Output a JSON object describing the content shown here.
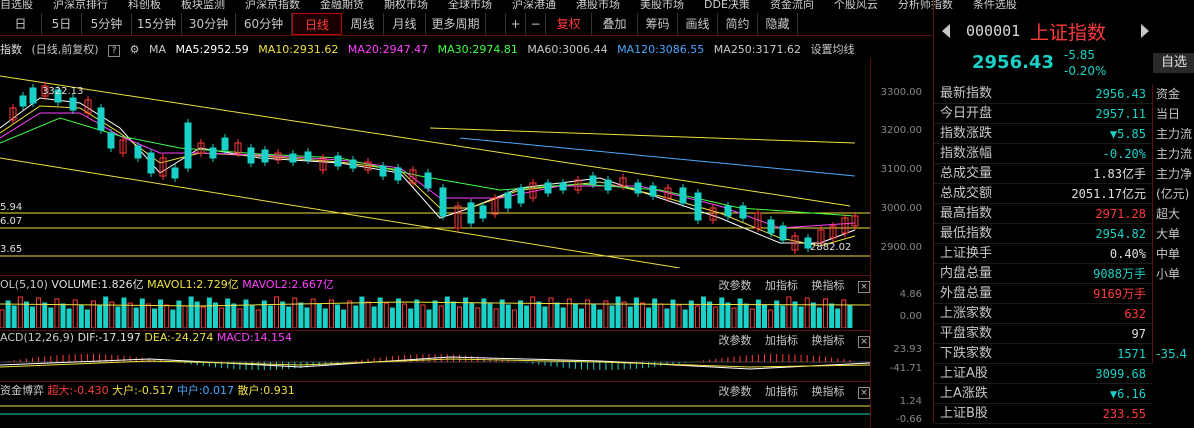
{
  "topnav": [
    "自选股",
    "沪深京排行",
    "科创板",
    "板块监测",
    "沪深京指数",
    "金融期货",
    "期权市场",
    "全球市场",
    "沪深港通",
    "港股市场",
    "美股市场",
    "DDE决策",
    "资金流向",
    "个股风云",
    "分析师指数",
    "条件选股"
  ],
  "toolbar": {
    "items": [
      "日",
      "5日",
      "5分钟",
      "15分钟",
      "30分钟",
      "60分钟",
      "日线",
      "周线",
      "月线",
      "更多周期",
      "",
      "+",
      "−",
      "复权",
      "叠加",
      "筹码",
      "画线",
      "简约",
      "隐藏"
    ],
    "active": "日线",
    "fuquan": "复权"
  },
  "legend": {
    "title": "指数",
    "subtitle": "(日线,前复权)",
    "ma": "MA",
    "ma5": "MA5:2952.59",
    "ma10": "MA10:2931.62",
    "ma20": "MA20:2947.47",
    "ma30": "MA30:2974.81",
    "ma60": "MA60:3006.44",
    "ma120": "MA120:3086.55",
    "ma250": "MA250:3171.62",
    "settings": "设置均线",
    "colors": {
      "ma5": "#ffffff",
      "ma10": "#f0e040",
      "ma20": "#ff40ff",
      "ma30": "#40ff40",
      "ma60": "#c8c8c8",
      "ma120": "#4aa8ff",
      "ma250": "#c8c8c8"
    }
  },
  "chart_annotations": {
    "high_label": "3322.13",
    "low_label": "2882.02",
    "left_labels": [
      "5.94",
      "6.07",
      "3.65"
    ]
  },
  "price_axis": [
    "3300.00",
    "3200.00",
    "3100.00",
    "3000.00",
    "2900.00"
  ],
  "volume": {
    "title": "OL(5,10)",
    "volume": "VOLUME:1.826亿",
    "mavol1": "MAVOL1:2.729亿",
    "mavol2": "MAVOL2:2.667亿",
    "axis": [
      "4.86",
      "0.00"
    ]
  },
  "macd": {
    "title": "ACD(12,26,9)",
    "dif": "DIF:-17.197",
    "dea": "DEA:-24.274",
    "macd": "MACD:14.154",
    "axis": [
      "23.93",
      "-41.71"
    ]
  },
  "fund": {
    "title": "资金博弈",
    "chaoda": "超大:-0.430",
    "dahu": "大户:-0.517",
    "zhonghu": "中户:0.017",
    "sanhu": "散户:0.931",
    "axis": [
      "1.24",
      "-0.66"
    ]
  },
  "sub_buttons": {
    "gaicanshu": "改参数",
    "jiazhibiao": "加指标",
    "huanzhibiao": "换指标",
    "close": "×"
  },
  "quote": {
    "code": "000001",
    "name": "上证指数",
    "price": "2956.43",
    "change": "-5.85",
    "change_pct": "-0.20%",
    "zixuan": "自选"
  },
  "stats": [
    {
      "k": "最新指数",
      "v": "2956.43",
      "c": "green"
    },
    {
      "k": "今日开盘",
      "v": "2957.11",
      "c": "green"
    },
    {
      "k": "指数涨跌",
      "v": "▼5.85",
      "c": "green"
    },
    {
      "k": "指数涨幅",
      "v": "-0.20%",
      "c": "green"
    },
    {
      "k": "总成交量",
      "v": "1.83亿手",
      "c": "white"
    },
    {
      "k": "总成交额",
      "v": "2051.17亿元",
      "c": "white"
    },
    {
      "k": "最高指数",
      "v": "2971.28",
      "c": "red"
    },
    {
      "k": "最低指数",
      "v": "2954.82",
      "c": "green"
    },
    {
      "k": "上证换手",
      "v": "0.40%",
      "c": "white"
    },
    {
      "k": "内盘总量",
      "v": "9088万手",
      "c": "green"
    },
    {
      "k": "外盘总量",
      "v": "9169万手",
      "c": "red"
    },
    {
      "k": "上涨家数",
      "v": "632",
      "c": "red"
    },
    {
      "k": "平盘家数",
      "v": "97",
      "c": "white"
    },
    {
      "k": "下跌家数",
      "v": "1571",
      "c": "green"
    },
    {
      "k": "上证A股",
      "v": "3099.68",
      "c": "green"
    },
    {
      "k": "上A涨跌",
      "v": "▼6.16",
      "c": "green"
    },
    {
      "k": "上证B股",
      "v": "233.55",
      "c": "red"
    }
  ],
  "side": [
    "资金",
    "当日",
    "主力流",
    "主力流",
    "主力净",
    "(亿元)",
    "超大",
    "大单",
    "中单",
    "小单",
    "",
    "",
    "",
    "-35.4"
  ]
}
